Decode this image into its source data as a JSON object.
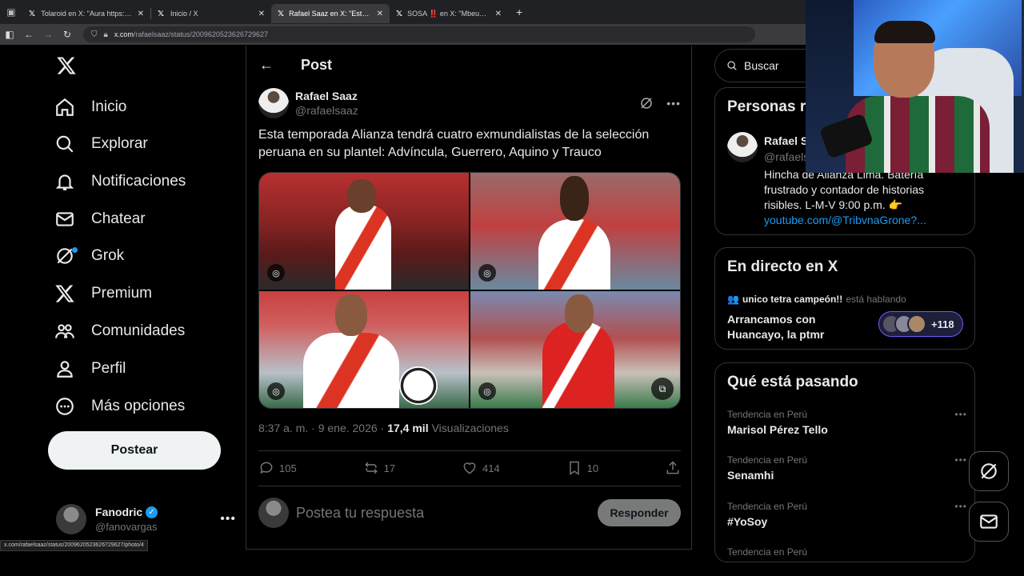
{
  "browser": {
    "tabs": [
      {
        "title": "Tolaroid en X: \"Aura https://t.co",
        "active": false
      },
      {
        "title": "Inicio / X",
        "active": false
      },
      {
        "title": "Rafael Saaz en X: \"Esta tempora",
        "active": true
      },
      {
        "title": "SOSA ‼️ en X: \"Mbeumo https:",
        "active": false
      }
    ],
    "url_host": "x.com",
    "url_path": "/rafaelsaaz/status/2009620523626729627",
    "status_link": "x.com/rafaelsaaz/status/2009620523626729627/photo/4"
  },
  "nav": {
    "items": [
      {
        "label": "Inicio",
        "icon": "home-icon"
      },
      {
        "label": "Explorar",
        "icon": "search-icon"
      },
      {
        "label": "Notificaciones",
        "icon": "bell-icon"
      },
      {
        "label": "Chatear",
        "icon": "mail-icon"
      },
      {
        "label": "Grok",
        "icon": "grok-icon"
      },
      {
        "label": "Premium",
        "icon": "x-logo-icon"
      },
      {
        "label": "Comunidades",
        "icon": "communities-icon"
      },
      {
        "label": "Perfil",
        "icon": "person-icon"
      },
      {
        "label": "Más opciones",
        "icon": "more-circle-icon"
      }
    ],
    "post_button": "Postear"
  },
  "account": {
    "name": "Fanodric",
    "handle": "@fanovargas"
  },
  "main": {
    "title": "Post",
    "post": {
      "author_name": "Rafael Saaz",
      "author_handle": "@rafaelsaaz",
      "text": "Esta temporada Alianza tendrá cuatro exmundialistas de la selección peruana en su plantel: Advíncula, Guerrero, Aquino y Trauco",
      "time": "8:37 a. m. · 9 ene. 2026 ·",
      "views_count": "17,4 mil",
      "views_label": "Visualizaciones",
      "replies": "105",
      "reposts": "17",
      "likes": "414",
      "bookmarks": "10"
    },
    "reply": {
      "placeholder": "Postea tu respuesta",
      "button": "Responder"
    }
  },
  "sidebar": {
    "search_placeholder": "Buscar",
    "related": {
      "title": "Personas r",
      "name": "Rafael S",
      "handle": "@rafaels",
      "bio": "Hincha de Alianza Lima. Batería frustrado y contador de historias risibles. L-M-V 9:00 p.m. 👉",
      "link": "youtube.com/@TribvnaGrone?..."
    },
    "live": {
      "title": "En directo en X",
      "host": "unico tetra campeón!!",
      "host_status": "está hablando",
      "space_title": "Arrancamos con Huancayo, la ptmr",
      "listeners": "+118"
    },
    "trends": {
      "title": "Qué está pasando",
      "items": [
        {
          "context": "Tendencia en Perú",
          "name": "Marisol Pérez Tello"
        },
        {
          "context": "Tendencia en Perú",
          "name": "Senamhi"
        },
        {
          "context": "Tendencia en Perú",
          "name": "#YoSoy"
        },
        {
          "context": "Tendencia en Perú",
          "name": ""
        }
      ]
    }
  },
  "colors": {
    "accent": "#1d9bf0",
    "background": "#000000",
    "border": "#2f3336",
    "muted": "#71767b"
  }
}
